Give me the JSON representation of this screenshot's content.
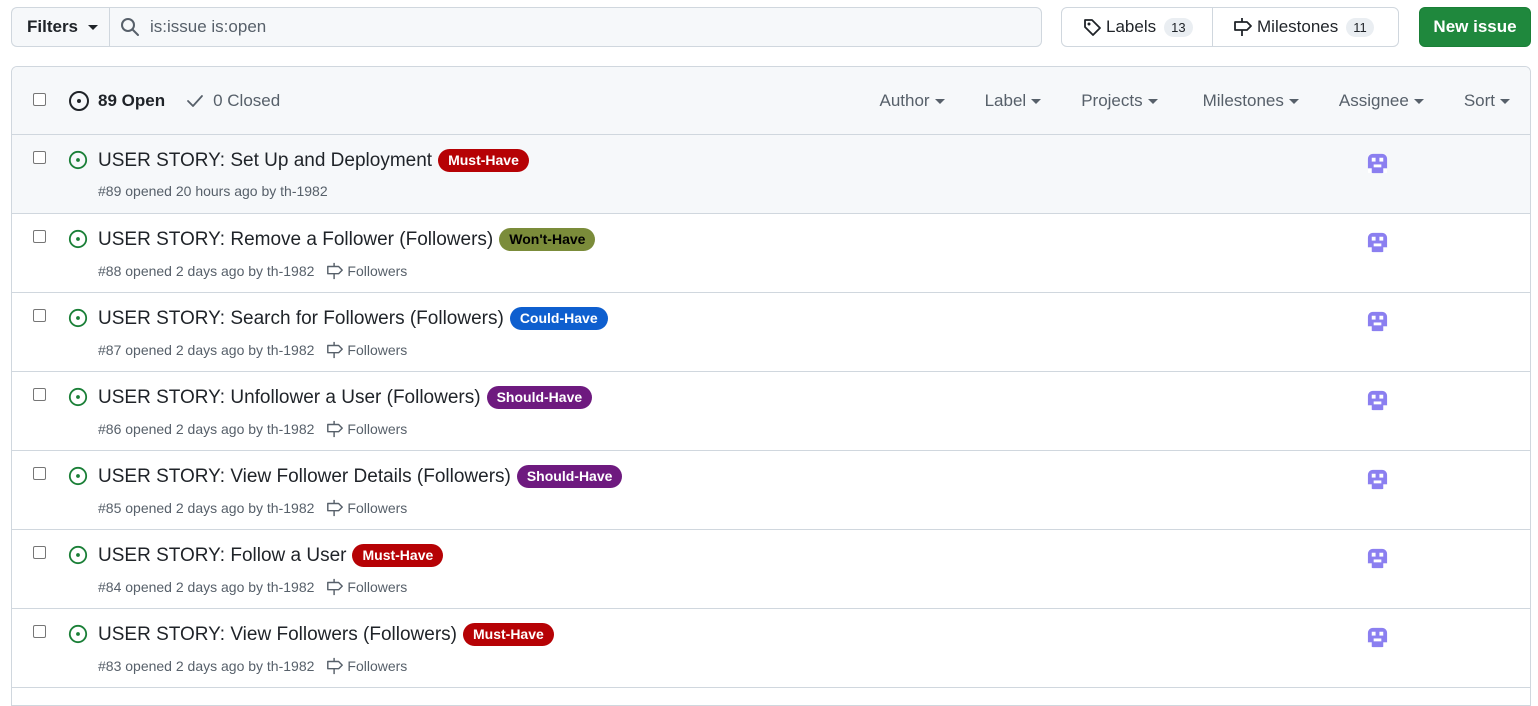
{
  "toolbar": {
    "filters_label": "Filters",
    "search_value": "is:issue is:open",
    "labels_label": "Labels",
    "labels_count": "13",
    "milestones_label": "Milestones",
    "milestones_count": "11",
    "new_issue_label": "New issue"
  },
  "header": {
    "open_label": "89 Open",
    "closed_label": "0 Closed",
    "filters": [
      "Author",
      "Label",
      "Projects",
      "Milestones",
      "Assignee",
      "Sort"
    ]
  },
  "colors": {
    "open_icon": "#1a7f37",
    "avatar": "#8b7ff0",
    "must_have": "#b60205",
    "wont_have": "#7b8c3a",
    "could_have": "#0e5fcf",
    "should_have": "#6e1a7f"
  },
  "issues": [
    {
      "title": "USER STORY: Set Up and Deployment",
      "label": "Must-Have",
      "label_bg": "#b60205",
      "label_fg": "#ffffff",
      "meta": "#89 opened 20 hours ago by th-1982",
      "milestone": ""
    },
    {
      "title": "USER STORY: Remove a Follower (Followers)",
      "label": "Won't-Have",
      "label_bg": "#7b8c3a",
      "label_fg": "#000000",
      "meta": "#88 opened 2 days ago by th-1982",
      "milestone": "Followers"
    },
    {
      "title": "USER STORY: Search for Followers (Followers)",
      "label": "Could-Have",
      "label_bg": "#0e5fcf",
      "label_fg": "#ffffff",
      "meta": "#87 opened 2 days ago by th-1982",
      "milestone": "Followers"
    },
    {
      "title": "USER STORY: Unfollower a User (Followers)",
      "label": "Should-Have",
      "label_bg": "#6e1a7f",
      "label_fg": "#ffffff",
      "meta": "#86 opened 2 days ago by th-1982",
      "milestone": "Followers"
    },
    {
      "title": "USER STORY: View Follower Details (Followers)",
      "label": "Should-Have",
      "label_bg": "#6e1a7f",
      "label_fg": "#ffffff",
      "meta": "#85 opened 2 days ago by th-1982",
      "milestone": "Followers"
    },
    {
      "title": "USER STORY: Follow a User",
      "label": "Must-Have",
      "label_bg": "#b60205",
      "label_fg": "#ffffff",
      "meta": "#84 opened 2 days ago by th-1982",
      "milestone": "Followers"
    },
    {
      "title": "USER STORY: View Followers (Followers)",
      "label": "Must-Have",
      "label_bg": "#b60205",
      "label_fg": "#ffffff",
      "meta": "#83 opened 2 days ago by th-1982",
      "milestone": "Followers"
    }
  ]
}
